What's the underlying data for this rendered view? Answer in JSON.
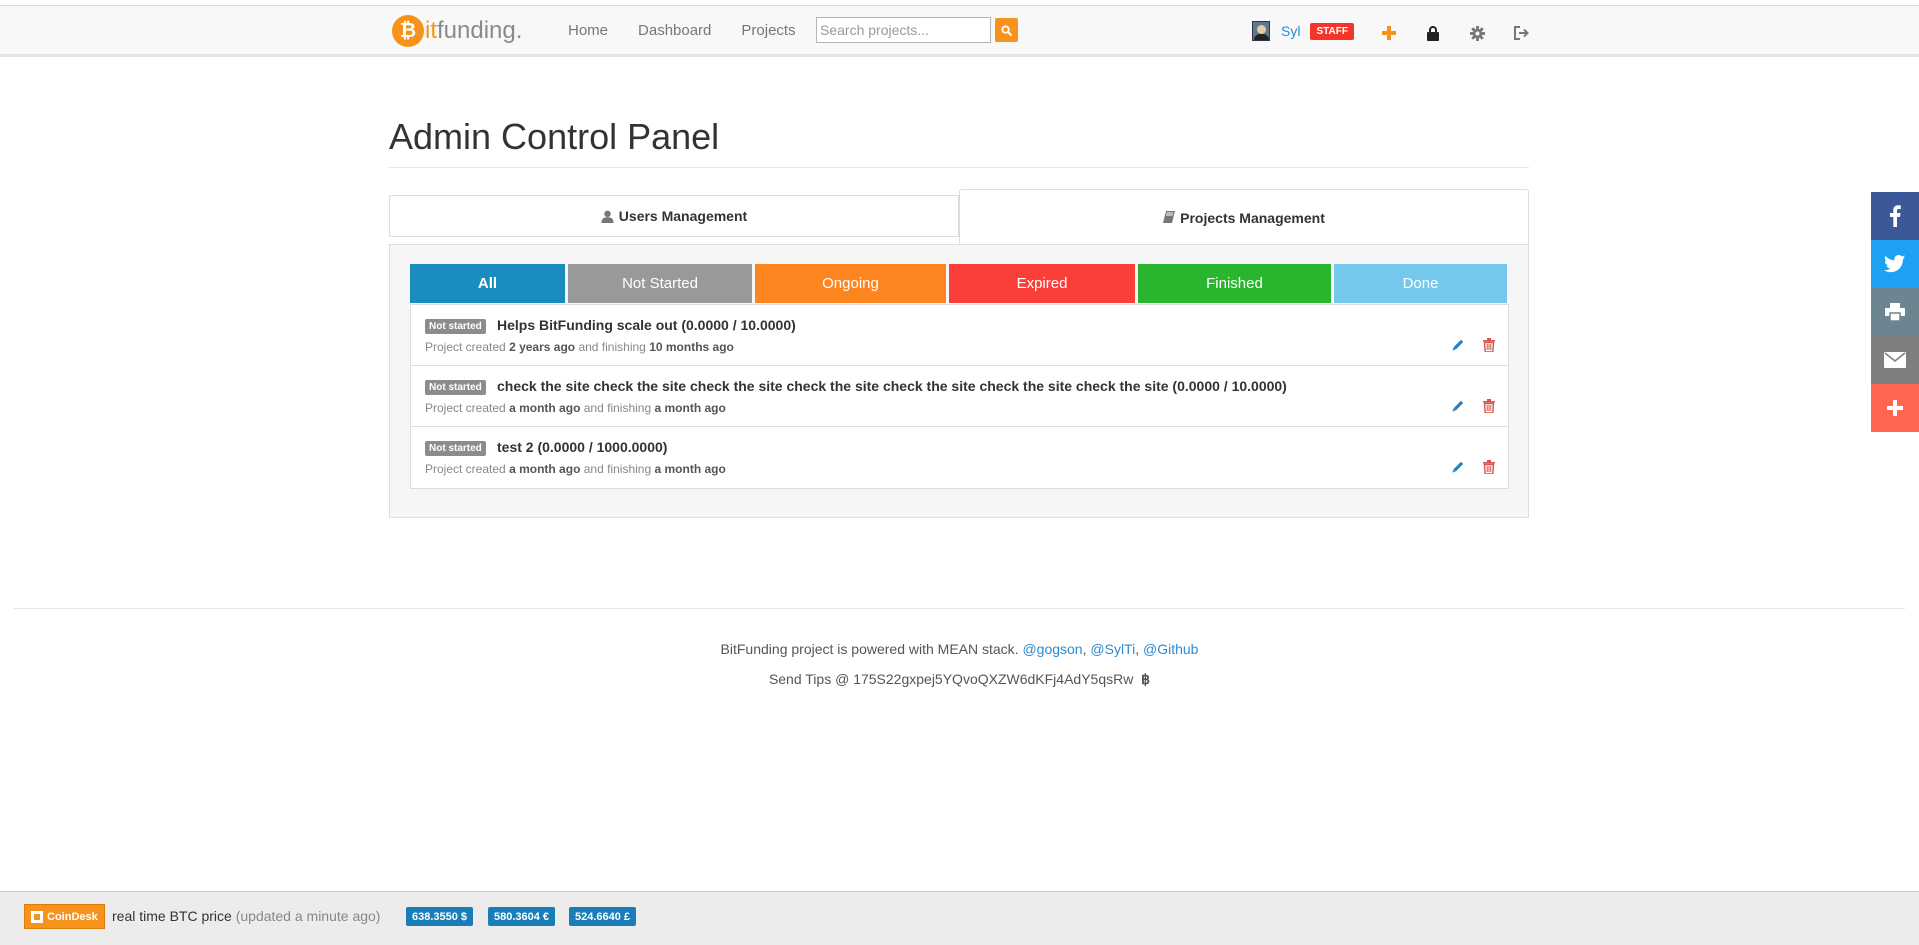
{
  "brand": {
    "logo_letter": "₿",
    "name_accent": "it",
    "name_rest": "funding."
  },
  "nav": {
    "links": [
      "Home",
      "Dashboard",
      "Projects"
    ],
    "search_placeholder": "Search projects...",
    "user_name": "Syl",
    "staff_badge": "STAFF",
    "icons": [
      "plus-icon",
      "lock-icon",
      "gear-icon",
      "logout-icon"
    ]
  },
  "page": {
    "title": "Admin Control Panel"
  },
  "tabs": {
    "users": "Users Management",
    "projects": "Projects Management"
  },
  "filters": [
    {
      "label": "All",
      "color": "#1a8cbf"
    },
    {
      "label": "Not Started",
      "color": "#999999"
    },
    {
      "label": "Ongoing",
      "color": "#fd8520"
    },
    {
      "label": "Expired",
      "color": "#fa3f39"
    },
    {
      "label": "Finished",
      "color": "#2ab52f"
    },
    {
      "label": "Done",
      "color": "#74c8ec"
    }
  ],
  "projects": [
    {
      "status": "Not started",
      "title": "Helps BitFunding scale out (0.0000 / 10.0000)",
      "meta_prefix": "Project created",
      "created": "2 years ago",
      "meta_mid": "and finishing",
      "finishing": "10 months ago"
    },
    {
      "status": "Not started",
      "title": "check the site check the site check the site check the site check the site check the site check the site (0.0000 / 10.0000)",
      "meta_prefix": "Project created",
      "created": "a month ago",
      "meta_mid": "and finishing",
      "finishing": "a month ago"
    },
    {
      "status": "Not started",
      "title": "test 2 (0.0000 / 1000.0000)",
      "meta_prefix": "Project created",
      "created": "a month ago",
      "meta_mid": "and finishing",
      "finishing": "a month ago"
    }
  ],
  "footer": {
    "line1_text": "BitFunding project is powered with MEAN stack.",
    "links": [
      "@gogson",
      "@SylTi",
      "@Github"
    ],
    "line2_text": "Send Tips @ 175S22gxpej5YQvoQXZW6dKFj4AdY5qsRw",
    "btc_symbol": "฿"
  },
  "share": [
    {
      "name": "facebook",
      "color": "#3b5998"
    },
    {
      "name": "twitter",
      "color": "#1da1f2"
    },
    {
      "name": "print",
      "color": "#6d8591"
    },
    {
      "name": "email",
      "color": "#7f7f7f"
    },
    {
      "name": "more",
      "color": "#ff6550"
    }
  ],
  "ticker": {
    "coindesk_label": "CoinDesk",
    "text": "real time BTC price",
    "updated": "(updated a minute ago)",
    "prices": [
      "638.3550 $",
      "580.3604 €",
      "524.6640 £"
    ]
  }
}
